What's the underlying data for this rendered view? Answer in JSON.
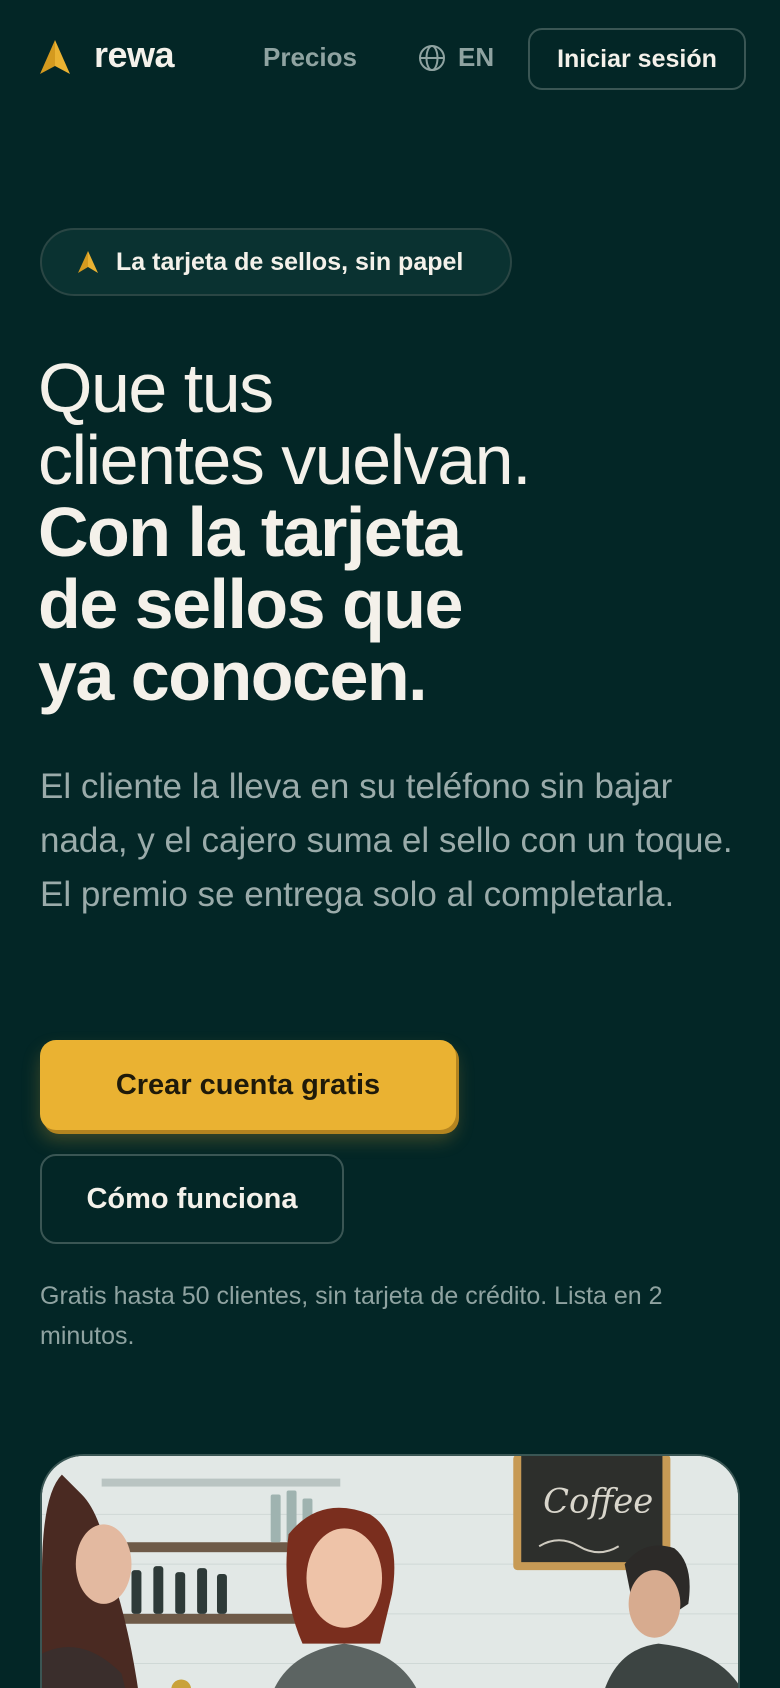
{
  "nav": {
    "brand": "rewa",
    "pricing_label": "Precios",
    "language_label": "EN",
    "login_label": "Iniciar sesión"
  },
  "hero": {
    "badge": "La tarjeta de sellos, sin papel",
    "headline_light": [
      "Que tus",
      "clientes vuelvan."
    ],
    "headline_bold": [
      "Con la tarjeta",
      "de sellos que",
      "ya conocen."
    ],
    "description": "El cliente la lleva en su teléfono sin bajar nada, y el cajero suma el sello con un toque. El premio se entrega solo al completarla.",
    "primary_cta": "Crear cuenta gratis",
    "secondary_cta": "Cómo funciona",
    "note": "Gratis hasta 50 clientes, sin tarjeta de crédito. Lista en 2 minutos."
  },
  "photo": {
    "sign_text": "Coffee"
  },
  "colors": {
    "background": "#032626",
    "accent": "#eab232",
    "text": "#f4f1ea",
    "muted": "#9aabaa"
  },
  "icons": {
    "logo": "rewa-arrow-logo-icon",
    "language": "globe-icon",
    "badge": "arrow-icon"
  }
}
